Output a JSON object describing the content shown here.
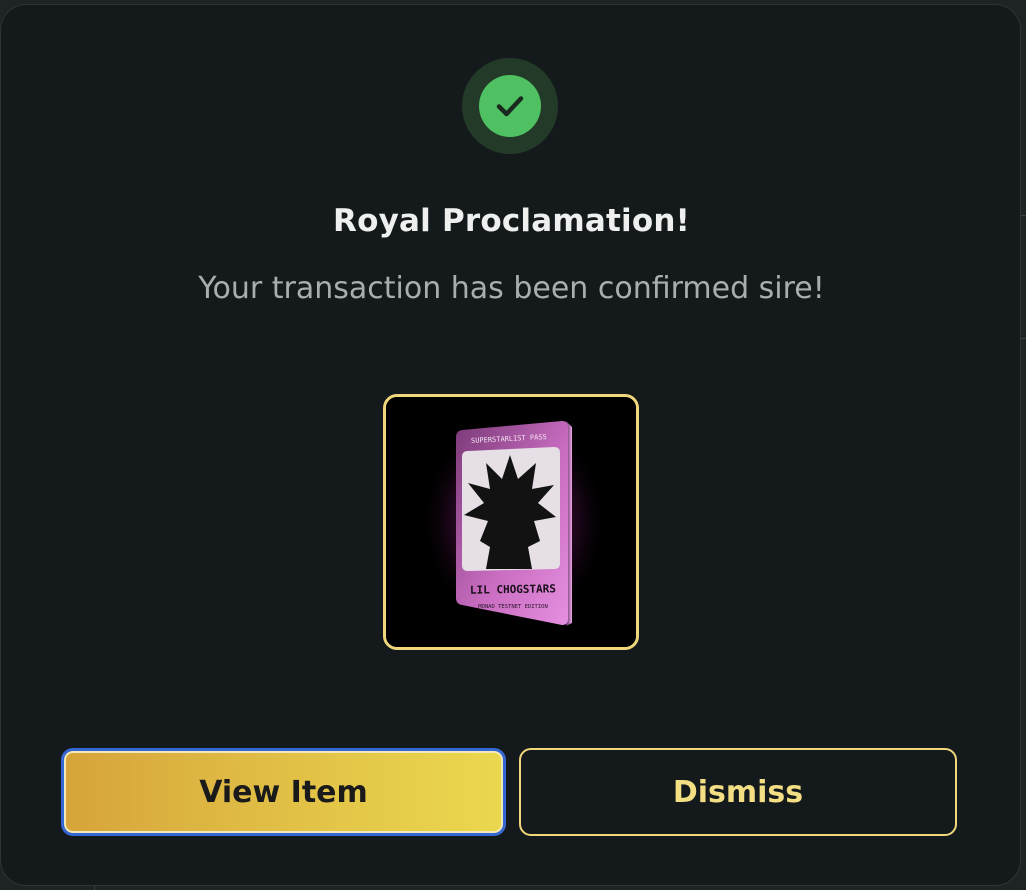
{
  "modal": {
    "title": "Royal Proclamation!",
    "subtitle": "Your transaction has been confirmed sire!",
    "status_icon": "check-circle-icon",
    "colors": {
      "background": "#141a1b",
      "success": "#4fc163",
      "accent": "#f0d77c",
      "focus_ring": "#3568d4"
    }
  },
  "item": {
    "card_header": "SUPERSTARLIST PASS",
    "card_name": "LIL CHOGSTARS",
    "card_edition": "MONAD TESTNET EDITION"
  },
  "actions": {
    "view_label": "View Item",
    "dismiss_label": "Dismiss"
  }
}
